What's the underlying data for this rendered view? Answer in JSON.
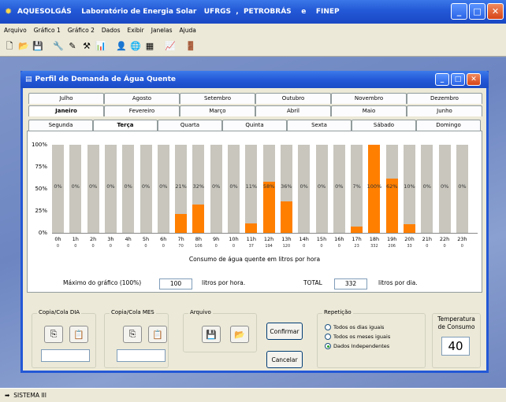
{
  "app": {
    "title": "AQUESOLGÁS    Laboratório de Energia Solar   UFRGS  ,  PETROBRÁS    e    FINEP",
    "menu": [
      "Arquivo",
      "Gráfico 1",
      "Gráfico 2",
      "Dados",
      "Exibir",
      "Janelas",
      "Ajuda"
    ],
    "toolbar_icons": [
      "new-file-icon",
      "open-folder-icon",
      "save-disk-icon",
      "tool-icon",
      "pencil-icon",
      "wrench-icon",
      "chart-icon",
      "person-icon",
      "globe-icon",
      "panel-icon",
      "graph-icon",
      "exit-icon"
    ],
    "status_text": "SISTEMA III"
  },
  "child": {
    "title": "Perfil de Demanda de Água Quente",
    "month_tabs_row1": [
      "Julho",
      "Agosto",
      "Setembro",
      "Outubro",
      "Novembro",
      "Dezembro"
    ],
    "month_tabs_row2": [
      "Janeiro",
      "Fevereiro",
      "Março",
      "Abril",
      "Maio",
      "Junho"
    ],
    "day_tabs": [
      "Segunda",
      "Terça",
      "Quarta",
      "Quinta",
      "Sexta",
      "Sábado",
      "Domingo"
    ],
    "active_month": "Janeiro",
    "active_day": "Terça"
  },
  "chart_data": {
    "type": "bar",
    "y_ticks": [
      "100%",
      "75%",
      "50%",
      "25%",
      "0%"
    ],
    "ylim": [
      0,
      100
    ],
    "categories": [
      "0h",
      "1h",
      "2h",
      "3h",
      "4h",
      "5h",
      "6h",
      "7h",
      "8h",
      "9h",
      "10h",
      "11h",
      "12h",
      "13h",
      "14h",
      "15h",
      "16h",
      "17h",
      "18h",
      "19h",
      "20h",
      "21h",
      "22h",
      "23h"
    ],
    "percent_labels": [
      "0%",
      "0%",
      "0%",
      "0%",
      "0%",
      "0%",
      "0%",
      "21%",
      "32%",
      "0%",
      "0%",
      "11%",
      "58%",
      "36%",
      "0%",
      "0%",
      "0%",
      "7%",
      "100%",
      "62%",
      "10%",
      "0%",
      "0%",
      "0%"
    ],
    "values": [
      0,
      0,
      0,
      0,
      0,
      0,
      0,
      21,
      32,
      0,
      0,
      11,
      58,
      36,
      0,
      0,
      0,
      7,
      100,
      62,
      10,
      0,
      0,
      0
    ],
    "sublabels": [
      "0",
      "0",
      "0",
      "0",
      "0",
      "0",
      "0",
      "70",
      "106",
      "0",
      "0",
      "37",
      "194",
      "120",
      "0",
      "0",
      "0",
      "23",
      "332",
      "206",
      "33",
      "0",
      "0",
      "0"
    ],
    "xlabel": "Consumo de água quente em litros por hora",
    "bar_color": "#ff7f00",
    "track_color": "#c8c6bd"
  },
  "fields": {
    "max_label": "Máximo do gráfico (100%)",
    "max_value": "100",
    "max_unit": "litros por hora.",
    "total_label": "TOTAL",
    "total_value": "332",
    "total_unit": "litros por dia."
  },
  "bottom": {
    "copy_day_label": "Copia/Cola DIA",
    "copy_month_label": "Copia/Cola MES",
    "file_label": "Arquivo",
    "confirm_label": "Confirmar",
    "cancel_label": "Cancelar",
    "repeat_label": "Repetição",
    "repeat_options": [
      "Todos os dias iguais",
      "Todos os meses iguais",
      "Dados Independentes"
    ],
    "repeat_selected": 2,
    "temp_label_1": "Temperatura",
    "temp_label_2": "de Consumo",
    "temp_value": "40"
  }
}
